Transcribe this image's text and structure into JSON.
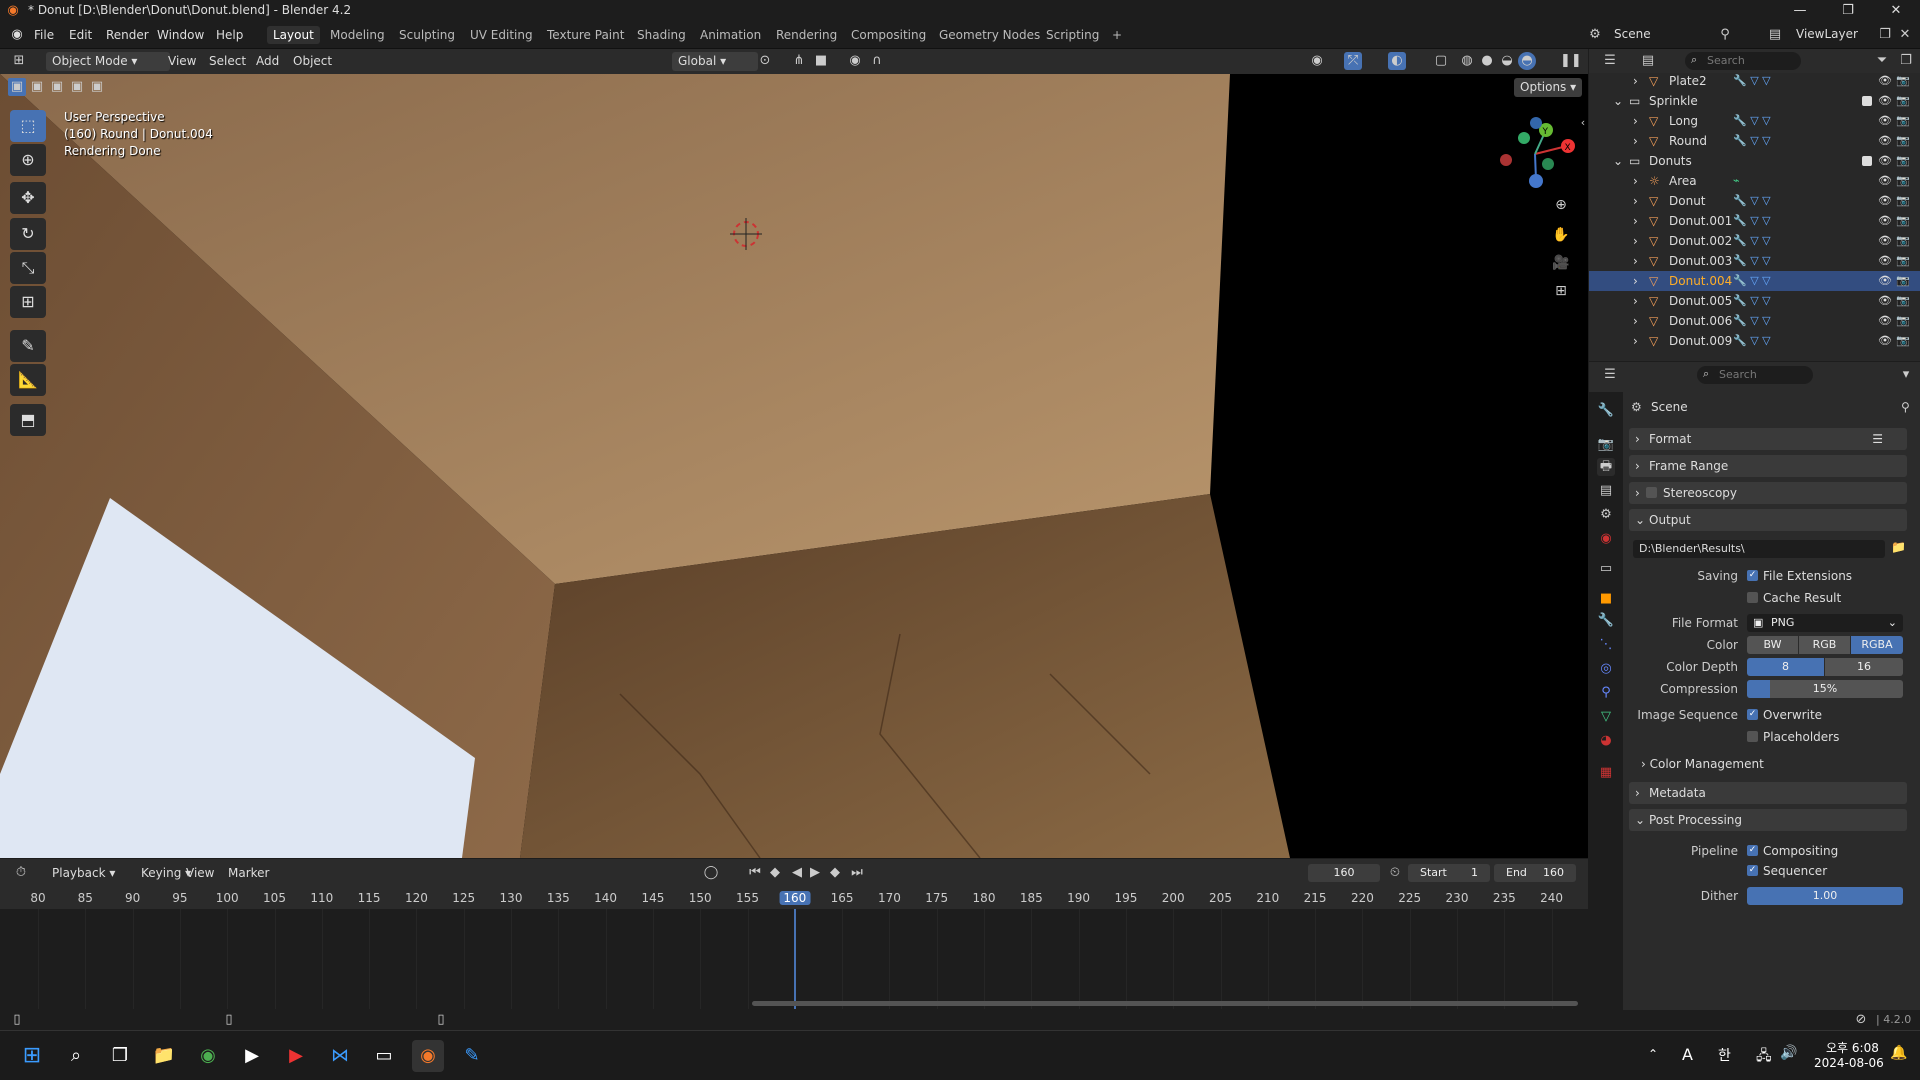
{
  "window": {
    "title": "* Donut [D:\\Blender\\Donut\\Donut.blend] - Blender 4.2"
  },
  "menu": [
    "File",
    "Edit",
    "Render",
    "Window",
    "Help"
  ],
  "workspaces": [
    "Layout",
    "Modeling",
    "Sculpting",
    "UV Editing",
    "Texture Paint",
    "Shading",
    "Animation",
    "Rendering",
    "Compositing",
    "Geometry Nodes",
    "Scripting"
  ],
  "scene_name": "Scene",
  "view_layer": "ViewLayer",
  "viewport_header": {
    "mode": "Object Mode",
    "menus": [
      "View",
      "Select",
      "Add",
      "Object"
    ],
    "orientation": "Global",
    "options": "Options"
  },
  "viewport_overlay": {
    "line1": "User Perspective",
    "line2": "(160) Round | Donut.004",
    "line3": "Rendering Done"
  },
  "outliner": {
    "search_placeholder": "Search",
    "rows": [
      {
        "name": "Plate2",
        "level": 2,
        "type": "object",
        "selected": false
      },
      {
        "name": "Sprinkle",
        "level": 1,
        "type": "collection",
        "selected": false
      },
      {
        "name": "Long",
        "level": 2,
        "type": "object",
        "selected": false
      },
      {
        "name": "Round",
        "level": 2,
        "type": "object",
        "selected": false
      },
      {
        "name": "Donuts",
        "level": 1,
        "type": "collection",
        "selected": false
      },
      {
        "name": "Area",
        "level": 2,
        "type": "light",
        "selected": false
      },
      {
        "name": "Donut",
        "level": 2,
        "type": "object",
        "selected": false
      },
      {
        "name": "Donut.001",
        "level": 2,
        "type": "object",
        "selected": false
      },
      {
        "name": "Donut.002",
        "level": 2,
        "type": "object",
        "selected": false
      },
      {
        "name": "Donut.003",
        "level": 2,
        "type": "object",
        "selected": false
      },
      {
        "name": "Donut.004",
        "level": 2,
        "type": "object",
        "selected": true
      },
      {
        "name": "Donut.005",
        "level": 2,
        "type": "object",
        "selected": false
      },
      {
        "name": "Donut.006",
        "level": 2,
        "type": "object",
        "selected": false
      },
      {
        "name": "Donut.009",
        "level": 2,
        "type": "object",
        "selected": false
      }
    ]
  },
  "properties": {
    "search_placeholder": "Search",
    "context": "Scene",
    "panels": {
      "format": "Format",
      "frame_range": "Frame Range",
      "stereoscopy": "Stereoscopy",
      "output": "Output",
      "output_path": "D:\\Blender\\Results\\",
      "saving_label": "Saving",
      "file_extensions": "File Extensions",
      "cache_result": "Cache Result",
      "file_format_label": "File Format",
      "file_format": "PNG",
      "color_label": "Color",
      "color_options": [
        "BW",
        "RGB",
        "RGBA"
      ],
      "color_selected": "RGBA",
      "color_depth_label": "Color Depth",
      "color_depth_options": [
        "8",
        "16"
      ],
      "color_depth_selected": "8",
      "compression_label": "Compression",
      "compression": "15%",
      "compression_value": 0.15,
      "image_sequence_label": "Image Sequence",
      "overwrite": "Overwrite",
      "placeholders": "Placeholders",
      "color_management": "Color Management",
      "metadata": "Metadata",
      "post_processing": "Post Processing",
      "pipeline_label": "Pipeline",
      "compositing": "Compositing",
      "sequencer": "Sequencer",
      "dither_label": "Dither",
      "dither": "1.00"
    }
  },
  "timeline": {
    "menus": [
      "Playback",
      "Keying",
      "View",
      "Marker"
    ],
    "current_frame": "160",
    "start_label": "Start",
    "start": "1",
    "end_label": "End",
    "end": "160",
    "ticks": [
      "80",
      "85",
      "90",
      "95",
      "100",
      "105",
      "110",
      "115",
      "120",
      "125",
      "130",
      "135",
      "140",
      "145",
      "150",
      "155",
      "160",
      "165",
      "170",
      "175",
      "180",
      "185",
      "190",
      "195",
      "200",
      "205",
      "210",
      "215",
      "220",
      "225",
      "230",
      "235",
      "240"
    ]
  },
  "status": {
    "version": "4.2.0"
  },
  "taskbar": {
    "time": "오후 6:08",
    "date": "2024-08-06",
    "lang_a": "A",
    "lang_ko": "한"
  }
}
